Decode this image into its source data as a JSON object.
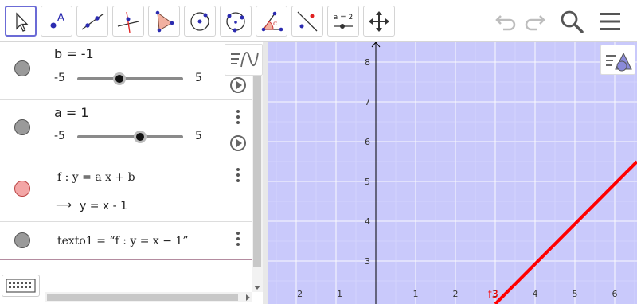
{
  "toolbar": {
    "tools": [
      {
        "name": "move-tool",
        "label": ""
      },
      {
        "name": "point-tool",
        "label": "A"
      },
      {
        "name": "line-tool",
        "label": ""
      },
      {
        "name": "perpendicular-line-tool",
        "label": ""
      },
      {
        "name": "polygon-tool",
        "label": ""
      },
      {
        "name": "circle-center-point-tool",
        "label": ""
      },
      {
        "name": "circle-three-points-tool",
        "label": ""
      },
      {
        "name": "angle-tool",
        "label": "α"
      },
      {
        "name": "reflect-tool",
        "label": ""
      },
      {
        "name": "slider-tool",
        "label": "a = 2"
      },
      {
        "name": "move-graphics-view-tool",
        "label": ""
      }
    ]
  },
  "algebra": {
    "rows": [
      {
        "label": "b = -1",
        "min": "-5",
        "max": "5",
        "value": -1
      },
      {
        "label": "a = 1",
        "min": "-5",
        "max": "5",
        "value": 1
      },
      {
        "definition": "f : y = a x + b",
        "result": "y = x - 1"
      },
      {
        "definition": "texto1  =   “f : y = x − 1”"
      }
    ]
  },
  "graphics": {
    "x_ticks": [
      "−2",
      "−1",
      "1",
      "2",
      "3",
      "4",
      "5",
      "6"
    ],
    "y_ticks": [
      "3",
      "4",
      "5",
      "6",
      "7",
      "8"
    ],
    "function_label": "f3",
    "line_color": "#ff0000",
    "background": "#c9c9fb"
  }
}
